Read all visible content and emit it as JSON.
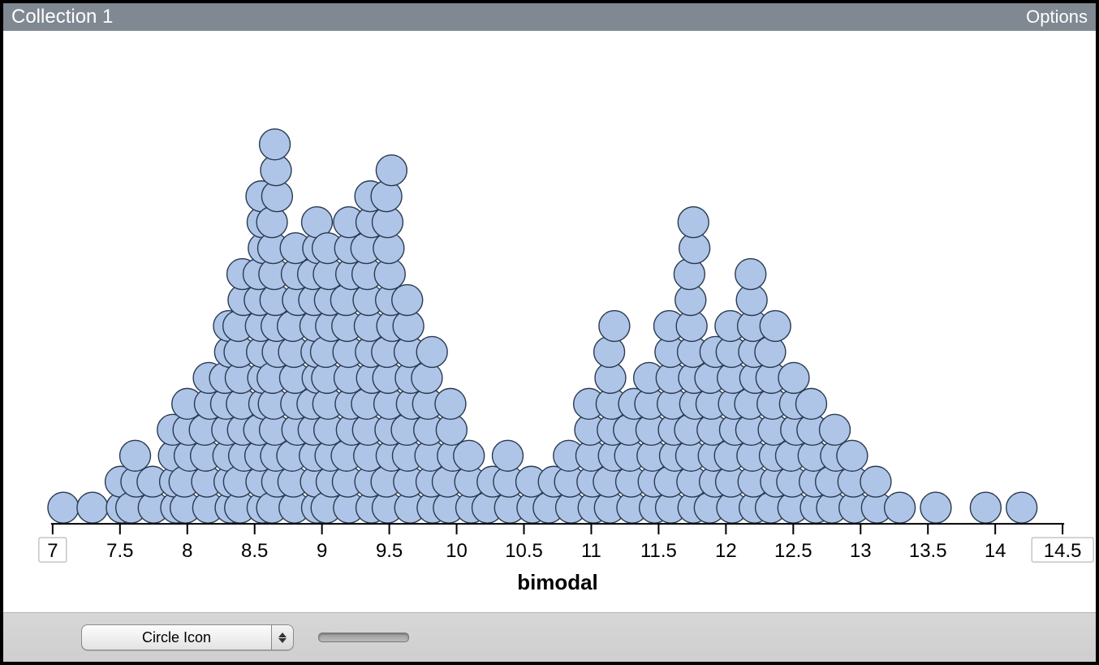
{
  "header": {
    "title": "Collection 1",
    "options_label": "Options"
  },
  "footer": {
    "dropdown_selected": "Circle Icon"
  },
  "chart_data": {
    "type": "dotplot",
    "xlabel": "bimodal",
    "x_ticks": [
      7,
      7.5,
      8,
      8.5,
      9,
      9.5,
      10,
      10.5,
      11,
      11.5,
      12,
      12.5,
      13,
      13.5,
      14,
      14.5
    ],
    "xlim": [
      7,
      14.5
    ],
    "dot_color": "#aec5e7",
    "dot_stroke": "#2a3a52",
    "bins": [
      {
        "x": 7.1,
        "count": 1
      },
      {
        "x": 7.3,
        "count": 1
      },
      {
        "x": 7.5,
        "count": 2
      },
      {
        "x": 7.6,
        "count": 3
      },
      {
        "x": 7.75,
        "count": 2
      },
      {
        "x": 7.9,
        "count": 4
      },
      {
        "x": 8.0,
        "count": 5
      },
      {
        "x": 8.15,
        "count": 6
      },
      {
        "x": 8.3,
        "count": 8
      },
      {
        "x": 8.4,
        "count": 10
      },
      {
        "x": 8.55,
        "count": 13
      },
      {
        "x": 8.65,
        "count": 15
      },
      {
        "x": 8.8,
        "count": 11
      },
      {
        "x": 8.95,
        "count": 12
      },
      {
        "x": 9.05,
        "count": 11
      },
      {
        "x": 9.2,
        "count": 12
      },
      {
        "x": 9.35,
        "count": 13
      },
      {
        "x": 9.5,
        "count": 14
      },
      {
        "x": 9.65,
        "count": 9
      },
      {
        "x": 9.8,
        "count": 7
      },
      {
        "x": 9.95,
        "count": 5
      },
      {
        "x": 10.1,
        "count": 3
      },
      {
        "x": 10.25,
        "count": 2
      },
      {
        "x": 10.4,
        "count": 3
      },
      {
        "x": 10.55,
        "count": 2
      },
      {
        "x": 10.7,
        "count": 2
      },
      {
        "x": 10.85,
        "count": 3
      },
      {
        "x": 11.0,
        "count": 5
      },
      {
        "x": 11.15,
        "count": 8
      },
      {
        "x": 11.3,
        "count": 5
      },
      {
        "x": 11.45,
        "count": 6
      },
      {
        "x": 11.6,
        "count": 8
      },
      {
        "x": 11.75,
        "count": 12
      },
      {
        "x": 11.9,
        "count": 7
      },
      {
        "x": 12.05,
        "count": 8
      },
      {
        "x": 12.2,
        "count": 10
      },
      {
        "x": 12.35,
        "count": 8
      },
      {
        "x": 12.5,
        "count": 6
      },
      {
        "x": 12.65,
        "count": 5
      },
      {
        "x": 12.8,
        "count": 4
      },
      {
        "x": 12.95,
        "count": 3
      },
      {
        "x": 13.1,
        "count": 2
      },
      {
        "x": 13.3,
        "count": 1
      },
      {
        "x": 13.55,
        "count": 1
      },
      {
        "x": 13.95,
        "count": 1
      },
      {
        "x": 14.2,
        "count": 1
      }
    ]
  }
}
